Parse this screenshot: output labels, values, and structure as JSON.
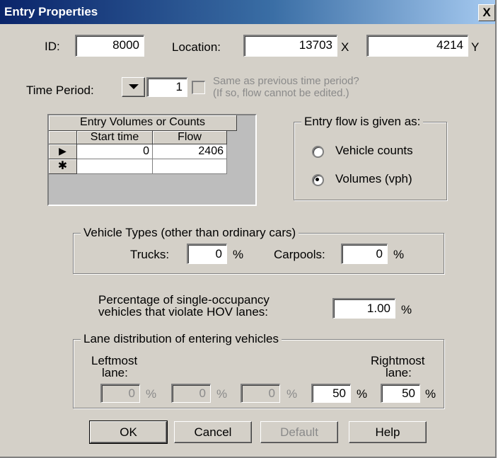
{
  "window": {
    "title": "Entry Properties",
    "close_label": "X"
  },
  "id": {
    "label": "ID:",
    "value": "8000"
  },
  "location": {
    "label": "Location:",
    "x_value": "13703",
    "x_unit": "X",
    "y_value": "4214",
    "y_unit": "Y"
  },
  "time_period": {
    "label": "Time Period:",
    "value": "1",
    "same_as_line1": "Same as previous time period?",
    "same_as_line2": "(If so, flow cannot be edited.)"
  },
  "entry_grid": {
    "title": "Entry Volumes or Counts",
    "columns": [
      "Start time",
      "Flow"
    ],
    "rows": [
      {
        "marker": "▶",
        "start_time": "0",
        "flow": "2406"
      },
      {
        "marker": "✱",
        "start_time": "",
        "flow": ""
      }
    ]
  },
  "flow_type": {
    "title": "Entry flow is given as:",
    "options": [
      "Vehicle counts",
      "Volumes (vph)"
    ],
    "selected": "Volumes (vph)"
  },
  "vehicle_types": {
    "title": "Vehicle Types (other than ordinary cars)",
    "trucks_label": "Trucks:",
    "trucks_value": "0",
    "carpools_label": "Carpools:",
    "carpools_value": "0",
    "unit": "%"
  },
  "hov": {
    "line1": "Percentage of single-occupancy",
    "line2": "vehicles that violate HOV lanes:",
    "value": "1.00",
    "unit": "%"
  },
  "lane_distribution": {
    "title": "Lane distribution of entering vehicles",
    "leftmost_line1": "Leftmost",
    "leftmost_line2": "lane:",
    "rightmost_line1": "Rightmost",
    "rightmost_line2": "lane:",
    "lanes": [
      "0",
      "0",
      "0",
      "50",
      "50"
    ],
    "unit": "%"
  },
  "buttons": {
    "ok": "OK",
    "cancel": "Cancel",
    "default": "Default",
    "help": "Help"
  }
}
